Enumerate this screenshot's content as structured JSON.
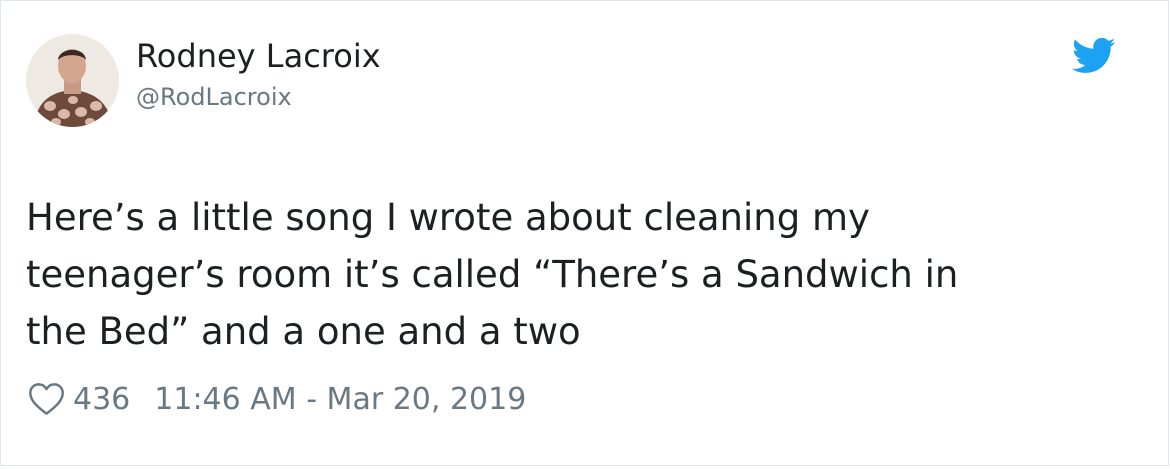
{
  "tweet": {
    "author": {
      "display_name": "Rodney Lacroix",
      "handle": "@RodLacroix",
      "avatar": "profile-photo"
    },
    "brand_icon": "twitter-bird-icon",
    "accent_color": "#1da1f2",
    "text_lines": [
      "Here’s a little song I wrote about cleaning my",
      "teenager’s room it’s called “There’s a Sandwich in",
      "the Bed” and a one and a two"
    ],
    "likes": "436",
    "timestamp": "11:46 AM - Mar 20, 2019",
    "like_icon": "heart-outline-icon"
  }
}
